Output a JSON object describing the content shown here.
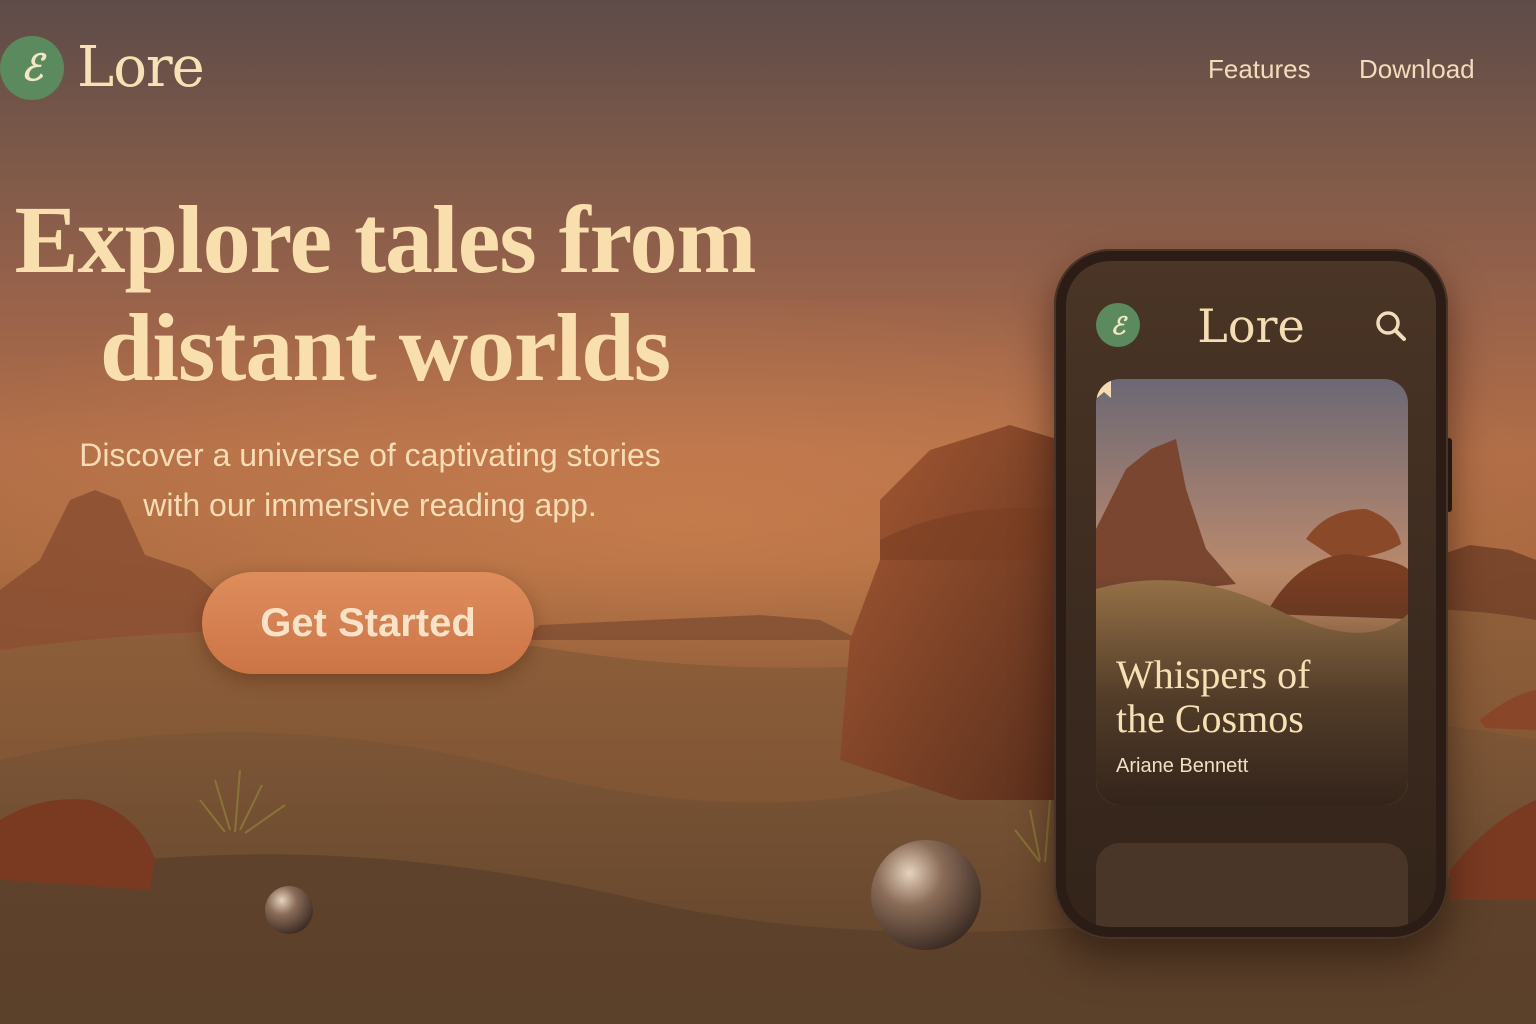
{
  "brand": {
    "name": "Lore",
    "logo_glyph": "ℰ",
    "logo_color": "#5b8a5f"
  },
  "nav": {
    "items": [
      {
        "label": "Features"
      },
      {
        "label": "Download"
      }
    ]
  },
  "hero": {
    "headline_line1": "Explore tales from",
    "headline_line2": "distant worlds",
    "subtitle_line1": "Discover a universe of captivating stories",
    "subtitle_line2": "with our immersive reading app.",
    "cta_label": "Get Started"
  },
  "phone": {
    "app_title": "Lore",
    "app_glyph": "ℰ",
    "search_icon": "search-icon",
    "featured_book": {
      "title_line1": "Whispers of",
      "title_line2": "the Cosmos",
      "author": "Ariane Bennett",
      "bookmark_icon": "bookmark-icon"
    }
  },
  "colors": {
    "accent": "#d98453",
    "text_cream": "#f9dfae",
    "background": "#9a634a"
  }
}
